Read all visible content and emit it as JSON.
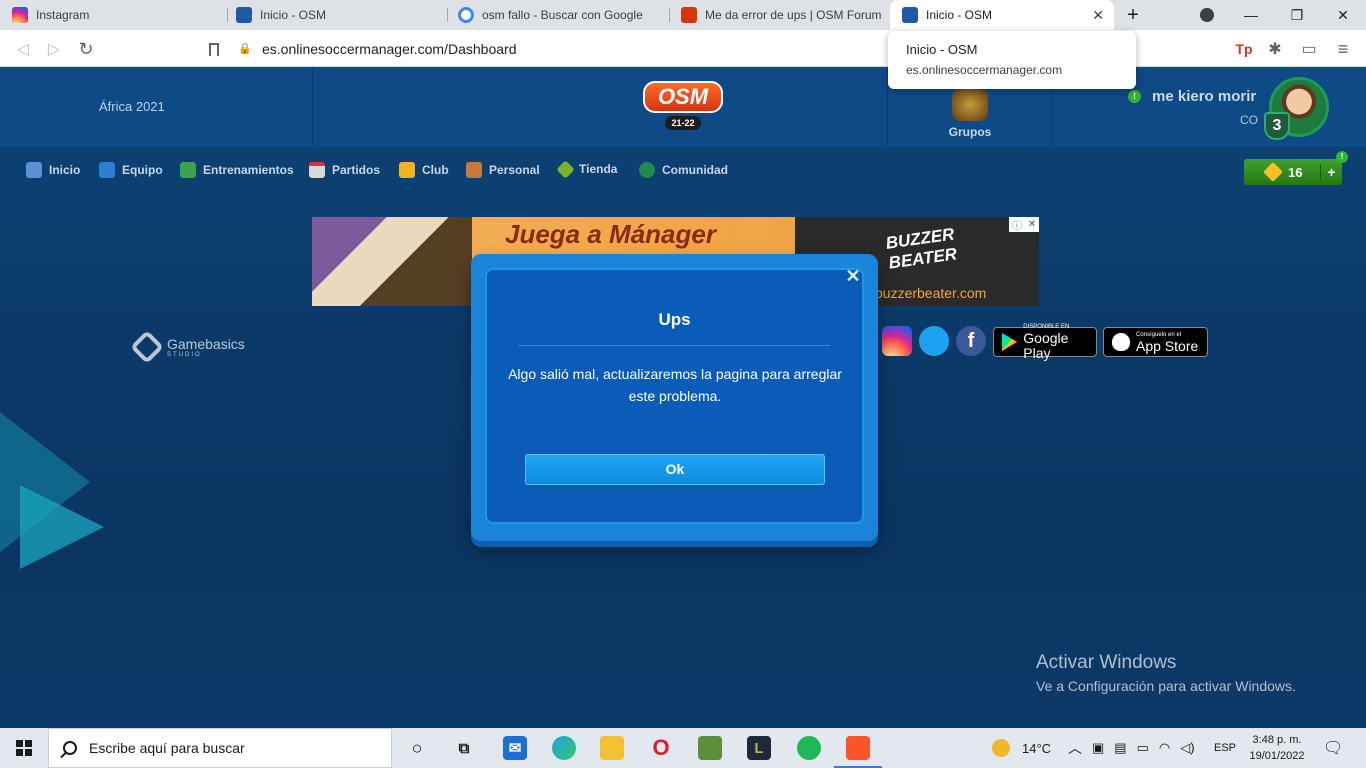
{
  "browser": {
    "tabs": [
      {
        "title": "Instagram",
        "favicon_color": "#d6249f"
      },
      {
        "title": "Inicio - OSM",
        "favicon_color": "#1e5aa8"
      },
      {
        "title": "osm fallo - Buscar con Google",
        "favicon_color": "#4285f4"
      },
      {
        "title": "Me da error de ups | OSM Forum",
        "favicon_color": "#d8350f"
      },
      {
        "title": "Inicio - OSM",
        "favicon_color": "#1e5aa8",
        "active": true
      }
    ],
    "new_tab_glyph": "+",
    "close_glyph": "✕",
    "url": "es.onlinesoccermanager.com/Dashboard",
    "hovercard": {
      "title": "Inicio - OSM",
      "url": "es.onlinesoccermanager.com"
    },
    "window_controls": [
      "—",
      "❐",
      "✕"
    ]
  },
  "header": {
    "season": "África 2021",
    "logo_text": "OSM",
    "logo_season": "21-22",
    "groups_label": "Grupos",
    "user_name": "me kiero morir",
    "user_club": "CO",
    "level": "3",
    "notify_badge": "!"
  },
  "nav": {
    "items": [
      {
        "label": "Inicio",
        "icon": "home-icon",
        "color": "#5b8fd6"
      },
      {
        "label": "Equipo",
        "icon": "shirt-icon",
        "color": "#2a7fd0"
      },
      {
        "label": "Entrenamientos",
        "icon": "training-icon",
        "color": "#39a24b"
      },
      {
        "label": "Partidos",
        "icon": "calendar-icon",
        "color": "#d9d9d9"
      },
      {
        "label": "Club",
        "icon": "club-icon",
        "color": "#f2b31f"
      },
      {
        "label": "Personal",
        "icon": "personal-icon",
        "color": "#c97a3a"
      },
      {
        "label": "Tienda",
        "icon": "shop-icon",
        "color": "#7ab32e"
      },
      {
        "label": "Comunidad",
        "icon": "community-icon",
        "color": "#1f8a4a"
      }
    ],
    "gems": "16",
    "gems_plus": "+",
    "gems_badge": "!"
  },
  "ad": {
    "headline": "Juega a Mánager",
    "brand": "BUZZER BEATER",
    "url": "buzzerbeater.com"
  },
  "footer": {
    "studio": "Gamebasics",
    "studio_sub": "STUDIO",
    "google_play_small": "DISPONIBLE EN",
    "google_play": "Google Play",
    "app_store_small": "Consíguelo en el",
    "app_store": "App Store"
  },
  "modal": {
    "title": "Ups",
    "message": "Algo salió mal, actualizaremos la pagina para arreglar este problema.",
    "ok_label": "Ok",
    "close_glyph": "✕"
  },
  "watermark": {
    "line1": "Activar Windows",
    "line2": "Ve a Configuración para activar Windows."
  },
  "taskbar": {
    "search_placeholder": "Escribe aquí para buscar",
    "weather": "14°C",
    "language": "ESP",
    "time": "3:48 p. m.",
    "date": "19/01/2022"
  }
}
